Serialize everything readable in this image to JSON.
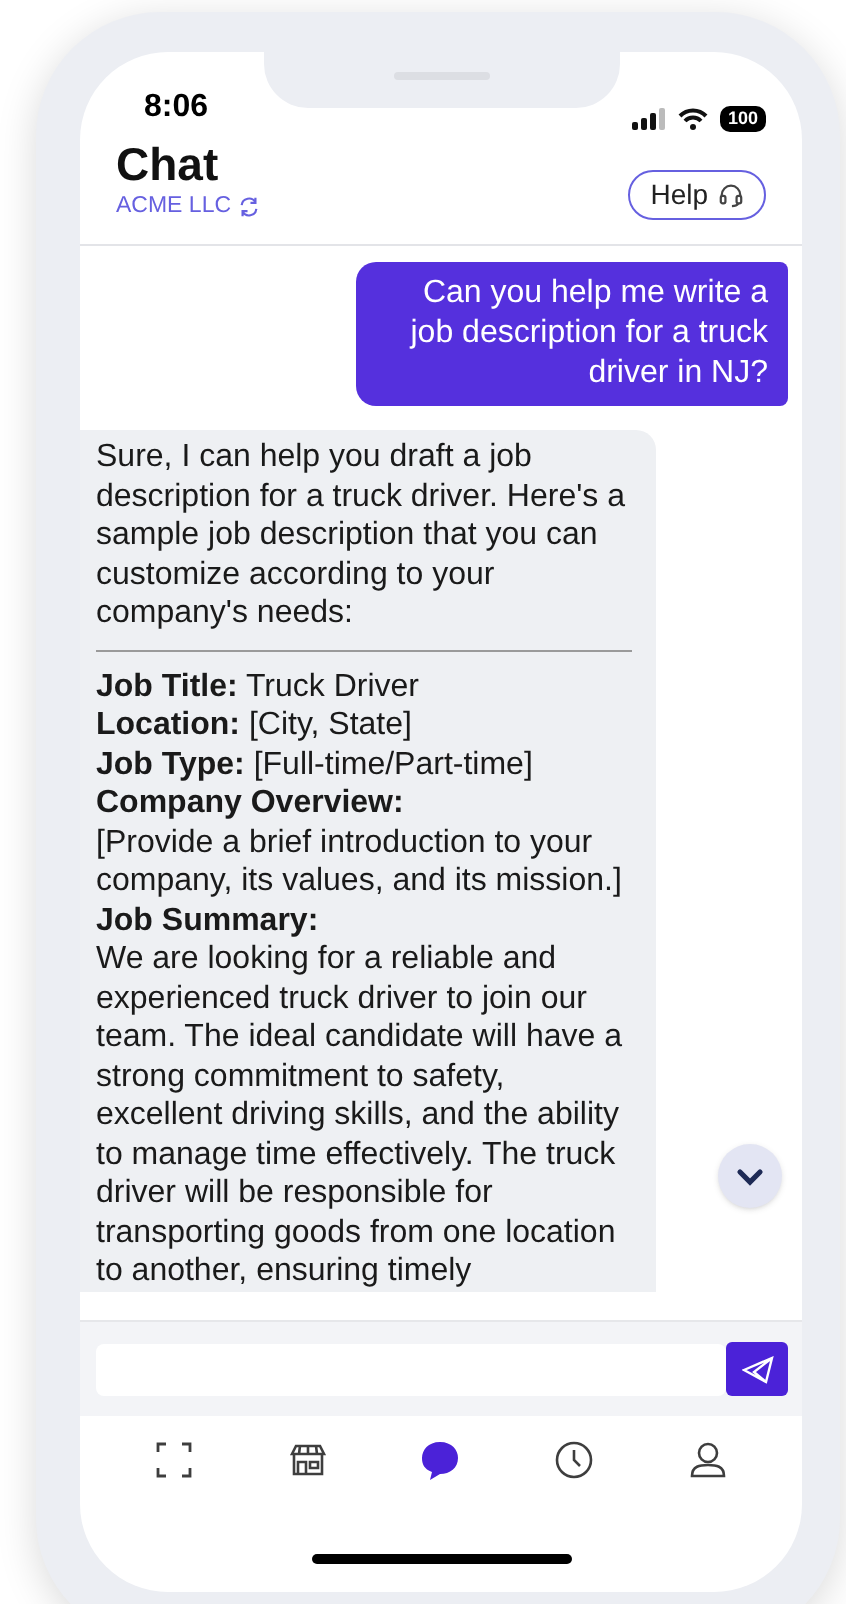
{
  "status_bar": {
    "time": "8:06",
    "battery": "100"
  },
  "header": {
    "title": "Chat",
    "company": "ACME LLC",
    "help_button": "Help"
  },
  "messages": [
    {
      "kind": "user",
      "text": "Can you help me write a job description for a truck driver in NJ?"
    },
    {
      "kind": "assistant",
      "blocks": [
        {
          "kind": "paragraph",
          "text": "Sure, I can help you draft a job description for a truck driver. Here's a sample job description that you can customize according to your company's needs:"
        },
        {
          "kind": "divider"
        },
        {
          "kind": "line",
          "text": "**Job Title:** Truck Driver"
        },
        {
          "kind": "line",
          "text": "**Location:** [City, State]"
        },
        {
          "kind": "line",
          "text": "**Job Type:** [Full-time/Part-time]"
        },
        {
          "kind": "heading",
          "text": "Company Overview:"
        },
        {
          "kind": "line",
          "text": "[Provide a brief introduction to your company, its values, and its mission.]"
        },
        {
          "kind": "heading",
          "text": "Job Summary:"
        },
        {
          "kind": "line",
          "text": "We are looking for a reliable and experienced truck driver to join our team. The ideal candidate will have a strong commitment to safety, excellent driving skills, and the ability to manage time effectively. The truck driver will be responsible for transporting goods from one location to another, ensuring timely"
        }
      ]
    }
  ],
  "tabs": [
    {
      "selected": false
    },
    {
      "selected": false
    },
    {
      "selected": true
    },
    {
      "selected": false
    },
    {
      "selected": false
    }
  ]
}
